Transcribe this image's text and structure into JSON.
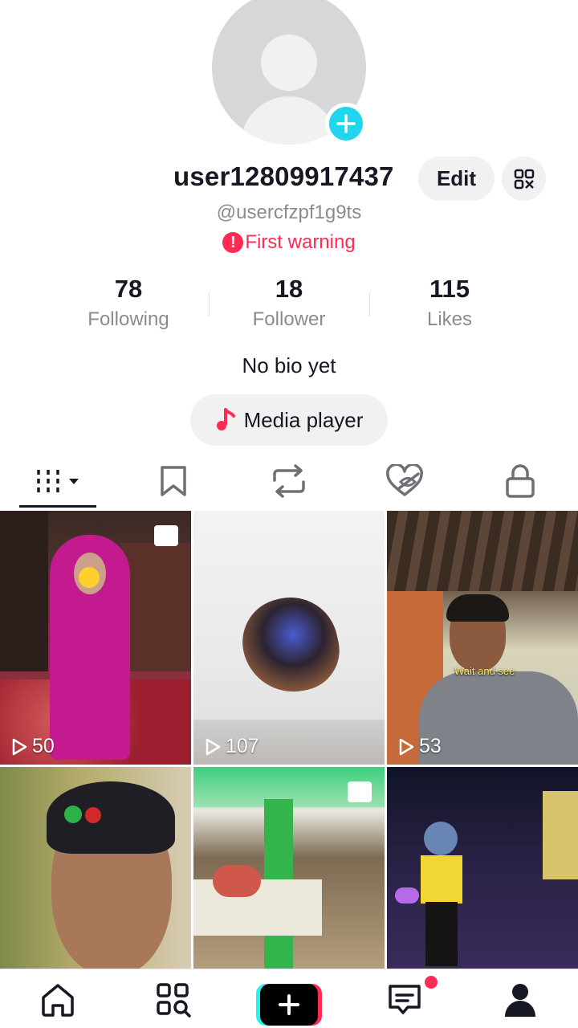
{
  "profile": {
    "username": "user12809917437",
    "handle": "@usercfzpf1g9ts",
    "warning": "First warning",
    "bio": "No bio yet",
    "edit_label": "Edit",
    "media_player_label": "Media player"
  },
  "stats": [
    {
      "value": "78",
      "label": "Following"
    },
    {
      "value": "18",
      "label": "Follower"
    },
    {
      "value": "115",
      "label": "Likes"
    }
  ],
  "tabs": [
    {
      "icon": "videos-grid-icon",
      "active": true
    },
    {
      "icon": "bookmark-icon",
      "active": false
    },
    {
      "icon": "repost-icon",
      "active": false
    },
    {
      "icon": "liked-hidden-icon",
      "active": false
    },
    {
      "icon": "lock-icon",
      "active": false
    }
  ],
  "videos": [
    {
      "views": "50",
      "photo": true
    },
    {
      "views": "107",
      "photo": false
    },
    {
      "views": "53",
      "photo": false,
      "caption": "Wait and see"
    },
    {
      "views": "",
      "photo": false
    },
    {
      "views": "",
      "photo": true
    },
    {
      "views": "",
      "photo": false
    }
  ],
  "bottom_nav": [
    {
      "icon": "home-icon"
    },
    {
      "icon": "explore-icon"
    },
    {
      "icon": "create-icon"
    },
    {
      "icon": "inbox-icon",
      "badge": true
    },
    {
      "icon": "profile-icon",
      "active": true
    }
  ],
  "colors": {
    "accent_red": "#fe2c55",
    "accent_cyan": "#20d5ec",
    "text_primary": "#161823",
    "text_secondary": "#8a8b91",
    "button_bg": "#f1f1f2"
  }
}
